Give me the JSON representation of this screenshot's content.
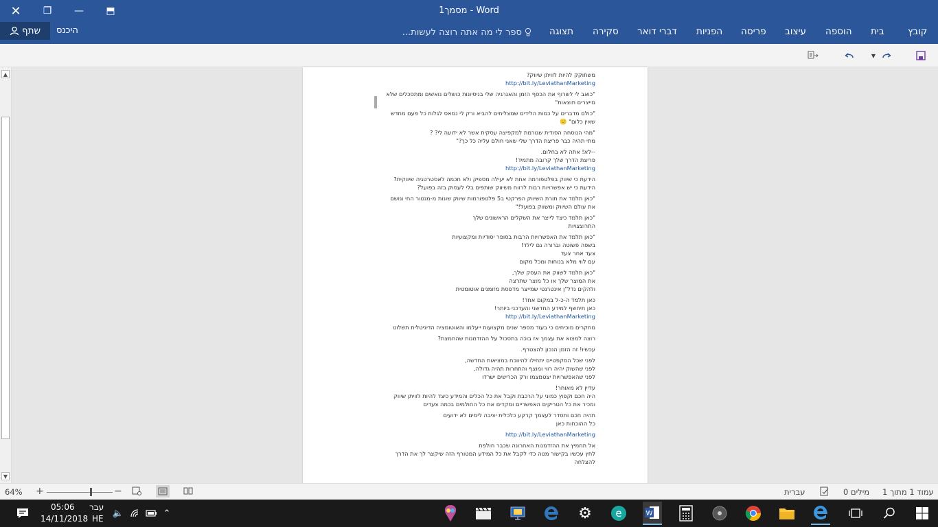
{
  "window": {
    "title": "מסמך1 - Word",
    "close_icon": "✕",
    "restore_icon": "❐",
    "minimize_icon": "—",
    "ribbon_display_icon": "⬒"
  },
  "ribbon": {
    "tabs": [
      "קובץ",
      "בית",
      "הוספה",
      "עיצוב",
      "פריסה",
      "הפניות",
      "דברי דואר",
      "סקירה",
      "תצוגה"
    ],
    "tell_me_placeholder": "ספר לי מה אתה רוצה לעשות...",
    "sign_in": "היכנס",
    "share": "שתף"
  },
  "document": {
    "paragraphs": [
      {
        "lines": [
          "משתוקק להיות לוויתן שיווק?"
        ],
        "link": "http://bit.ly/LeviathanMarketing"
      },
      {
        "lines": [
          "\"כואב לי לשרוף את הכסף הזמן והאנרגיה שלי בניסיונות כושלים נואשים ומתסכלים שלא",
          "מייצרים תוצאות\""
        ]
      },
      {
        "lines": [
          "\"כולם מדברים על כמות הלידים שמצליחים להביא ורק לי נמאס לגלות כל פעם מחדש",
          "שאין כלום\" 🙁"
        ]
      },
      {
        "lines": [
          "\"מהי הנוסחה הסודית שגורמת למקפיצה עסקית אשר לא ידועה לי? ?",
          "מתי תהיה כבר פריצת הדרך שלי שאני חולם עליה כל כך?\""
        ]
      },
      {
        "lines": [
          "--לא! אתה לא בחלום.",
          "פריצת הדרך שלך קרובה מתמיד!"
        ],
        "link": "http://bit.ly/LeviathanMarketing"
      },
      {
        "lines": [
          "הידעת כי שיווק בפלטפורמה אחת לא יעילה מספיק ולא חכמה לאסטרטגיה שיווקית?",
          "הידעת כי יש אפשרויות רבות לרווח משיווק שותפים בלי לעסוק בזה בפועל?"
        ]
      },
      {
        "lines": [
          "\"כאן תלמד את תורת השיווק הפרקטי ב5 פלטפורמות שיווק שונות מ-מנטור החי ונושם",
          "את עולם השיווק ומשווק בפועל!\""
        ]
      },
      {
        "lines": [
          "\"כאן תלמד כיצד לייצר את השקלים הראשונים שלך",
          "התרוצצויות"
        ]
      },
      {
        "lines": [
          "\"כאן תלמד את האפשרויות הרבות בסופר יסודיות ומקצועיות",
          "בשפה פשוטה וברורה גם לילד!",
          "צעד אחר צעד",
          "עם לווי מלא בנוחות ומכל מקום"
        ]
      },
      {
        "lines": [
          "\"כאן תלמד לשווק את העסק שלך,",
          "את המוצר שלך או כל מוצר שתרצה",
          "ולהקים נדל\"ן אינטרנטי שמייצר מדפסת מזומנים אוטומטית"
        ]
      },
      {
        "lines": [
          "כאן תלמד ה-כ-ל במקום אחד!",
          "כאן תיחשף למידע החדשני והעדכני ביותר!"
        ],
        "link": "http://bit.ly/LeviathanMarketing"
      },
      {
        "lines": [
          "מחקרים מוכיחים כי בעוד מספר שנים מקצועות ייעלמו והאוטומציה הדיגיטלית תשלוט"
        ]
      },
      {
        "lines": [
          "רוצה למצוא את עצמך אז בוכה בתסכול על ההזדמנות שהחמצת?"
        ]
      },
      {
        "lines": [
          "עכשיו! זה הזמן הנכון להצטרף."
        ]
      },
      {
        "lines": [
          "לפני שכל הסקפטיים יתחילו להיווכח במציאות החדשה,",
          "לפני שהשוק יהיה רווי ומוצף והתחרות תהיה גדולה,",
          "לפני שהאפשרויות יצטמצמו ורק הכרישים ישרדו"
        ]
      },
      {
        "lines": [
          "עדיין לא מאוחר!",
          "היה חכם וקפוץ כמוני על הרכבת וקבל את כל הכלים והמידע כיצד להיות לוויתן שיווק",
          "ומכיר את כל הטריקים האפשריים ומקדים את כל החולמים בכמה צעדים"
        ]
      },
      {
        "lines": [
          "תהיה חכם ותסדר לעצמך קרקע כלכלית יציבה לימים לא ידועים",
          "כל ההוכחות כאן"
        ]
      },
      {
        "lines": [],
        "link": "http://bit.ly/LeviathanMarketing"
      },
      {
        "lines": [
          "אל תחמיץ את ההזדמנות האחרונה שכבר חולפת",
          "לחץ עכשיו בקישור מטה כדי לקבל את כל המידע המטורף הזה שיקצר לך את הדרך",
          "להצלחה"
        ]
      }
    ]
  },
  "statusbar": {
    "page": "עמוד 1 מתוך 1",
    "words": "0 מילים",
    "language": "עברית",
    "zoom": "64%",
    "zoom_in": "+",
    "zoom_out": "−"
  },
  "taskbar": {
    "time": "05:06",
    "date": "14/11/2018",
    "lang_top": "עבר",
    "lang_bottom": "HE"
  }
}
